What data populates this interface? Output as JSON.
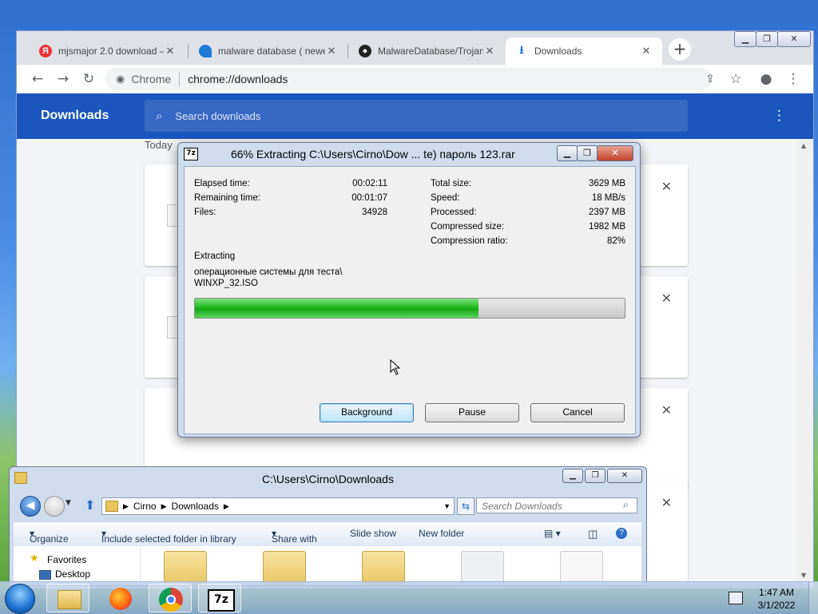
{
  "browser": {
    "tabs": [
      {
        "label": "mjsmajor 2.0 download –",
        "favicon": "yandex-icon"
      },
      {
        "label": "malware database ( newe",
        "favicon": "edge-icon"
      },
      {
        "label": "MalwareDatabase/Trojan",
        "favicon": "github-icon"
      },
      {
        "label": "Downloads",
        "favicon": "download-icon",
        "active": true
      }
    ],
    "site_label": "Chrome",
    "url": "chrome://downloads",
    "page_title": "Downloads",
    "search_placeholder": "Search downloads",
    "section_label": "Today"
  },
  "zip_dialog": {
    "title": "66% Extracting C:\\Users\\Cirno\\Dow ... te) пароль 123.rar",
    "logo": "7z",
    "left_stats": [
      {
        "label": "Elapsed time:",
        "value": "00:02:11"
      },
      {
        "label": "Remaining time:",
        "value": "00:01:07"
      },
      {
        "label": "Files:",
        "value": "34928"
      }
    ],
    "right_stats": [
      {
        "label": "Total size:",
        "value": "3629 MB"
      },
      {
        "label": "Speed:",
        "value": "18 MB/s"
      },
      {
        "label": "Processed:",
        "value": "2397 MB"
      },
      {
        "label": "Compressed size:",
        "value": "1982 MB"
      },
      {
        "label": "Compression ratio:",
        "value": "82%"
      }
    ],
    "status": "Extracting",
    "current_path": "операционные системы для теста\\",
    "current_file": "WINXP_32.ISO",
    "progress": 0.66,
    "buttons": {
      "background": "Background",
      "pause": "Pause",
      "cancel": "Cancel"
    }
  },
  "explorer": {
    "title": "C:\\Users\\Cirno\\Downloads",
    "breadcrumb": [
      "Cirno",
      "Downloads"
    ],
    "search_placeholder": "Search Downloads",
    "toolbar": {
      "organize": "Organize",
      "include": "Include selected folder in library",
      "share": "Share with",
      "slideshow": "Slide show",
      "new_folder": "New folder"
    },
    "nav": {
      "favorites": "Favorites",
      "desktop": "Desktop"
    }
  },
  "taskbar": {
    "time": "1:47 AM",
    "date": "3/1/2022",
    "z7_label": "7z"
  },
  "colors": {
    "chrome_blue": "#1a56be",
    "progress_green": "#22bb22"
  }
}
